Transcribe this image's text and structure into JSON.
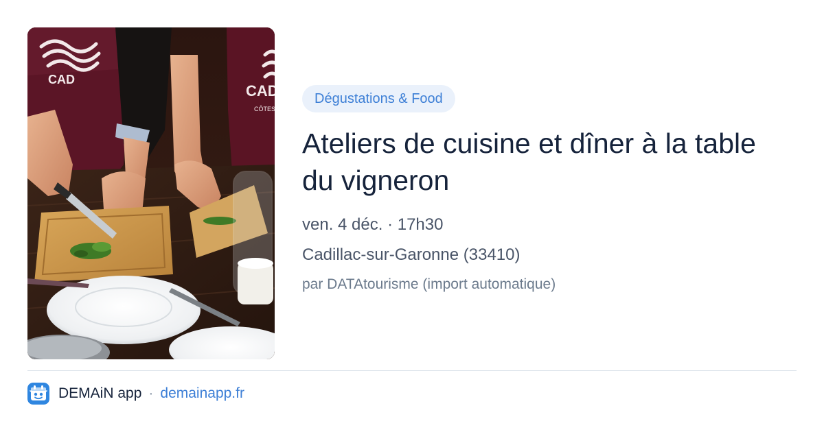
{
  "card": {
    "image_alt": "Atelier de cuisine : mains coupant des herbes sur une planche à découper",
    "category": "Dégustations & Food",
    "title": "Ateliers de cuisine et dîner à la table du vigneron",
    "date": "ven. 4 déc. · 17h30",
    "location": "Cadillac-sur-Garonne (33410)",
    "source": "par DATAtourisme (import automatique)"
  },
  "footer": {
    "app_icon": "demain-app-icon",
    "app_name": "DEMAiN app",
    "separator": "·",
    "domain": "demainapp.fr"
  },
  "colors": {
    "accent": "#3d7fd6",
    "pill_background": "#eaf1fb",
    "title": "#16233b",
    "body_text": "#4a5568",
    "muted_text": "#6b7a8c",
    "divider": "#dbe3ea"
  }
}
